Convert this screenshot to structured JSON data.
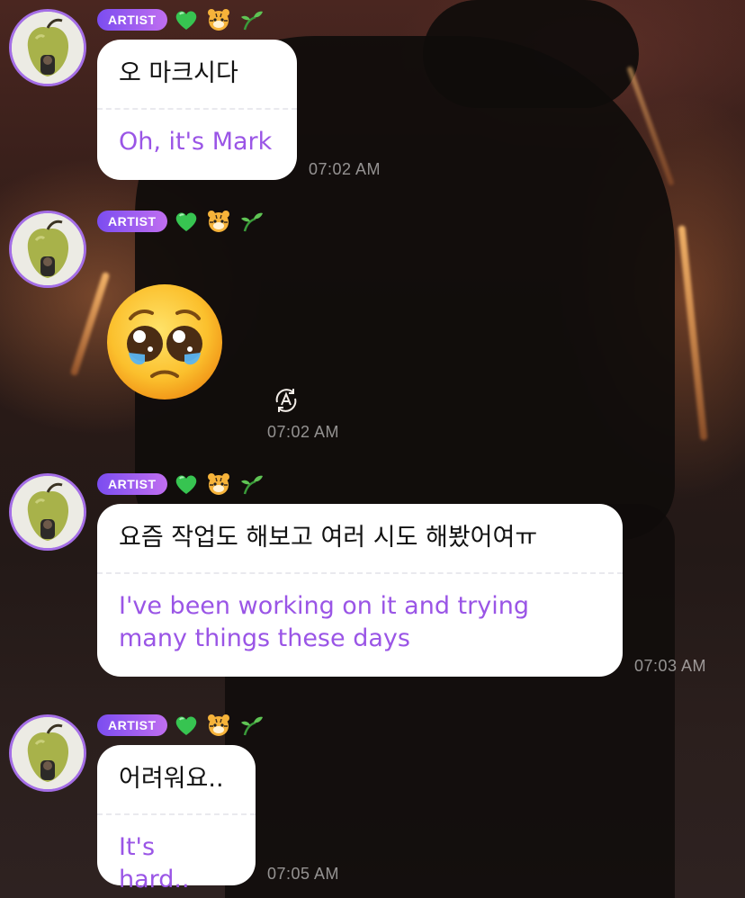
{
  "badge_label": "ARTIST",
  "badge_emojis": [
    "green-heart",
    "tiger-face",
    "seedling"
  ],
  "colors": {
    "bubble_bg": "#ffffff",
    "original_text": "#111111",
    "translation_text": "#9a55e6",
    "badge_gradient_start": "#7b4df0",
    "badge_gradient_end": "#c06ef0",
    "avatar_ring": "#a46ee6",
    "timestamp": "#9a9391"
  },
  "messages": [
    {
      "type": "text",
      "original": "오 마크시다",
      "translation": "Oh, it's Mark",
      "time": "07:02 AM"
    },
    {
      "type": "emoji",
      "emoji": "pleading-face",
      "time": "07:02 AM",
      "has_auto_translate_icon": true
    },
    {
      "type": "text",
      "original": "요즘 작업도 해보고 여러 시도 해봤어여ㅠ",
      "translation": "I've been working on it and trying many things these days",
      "time": "07:03 AM"
    },
    {
      "type": "text",
      "original": "어려워요..",
      "translation": "It's hard..",
      "time": "07:05 AM"
    }
  ]
}
